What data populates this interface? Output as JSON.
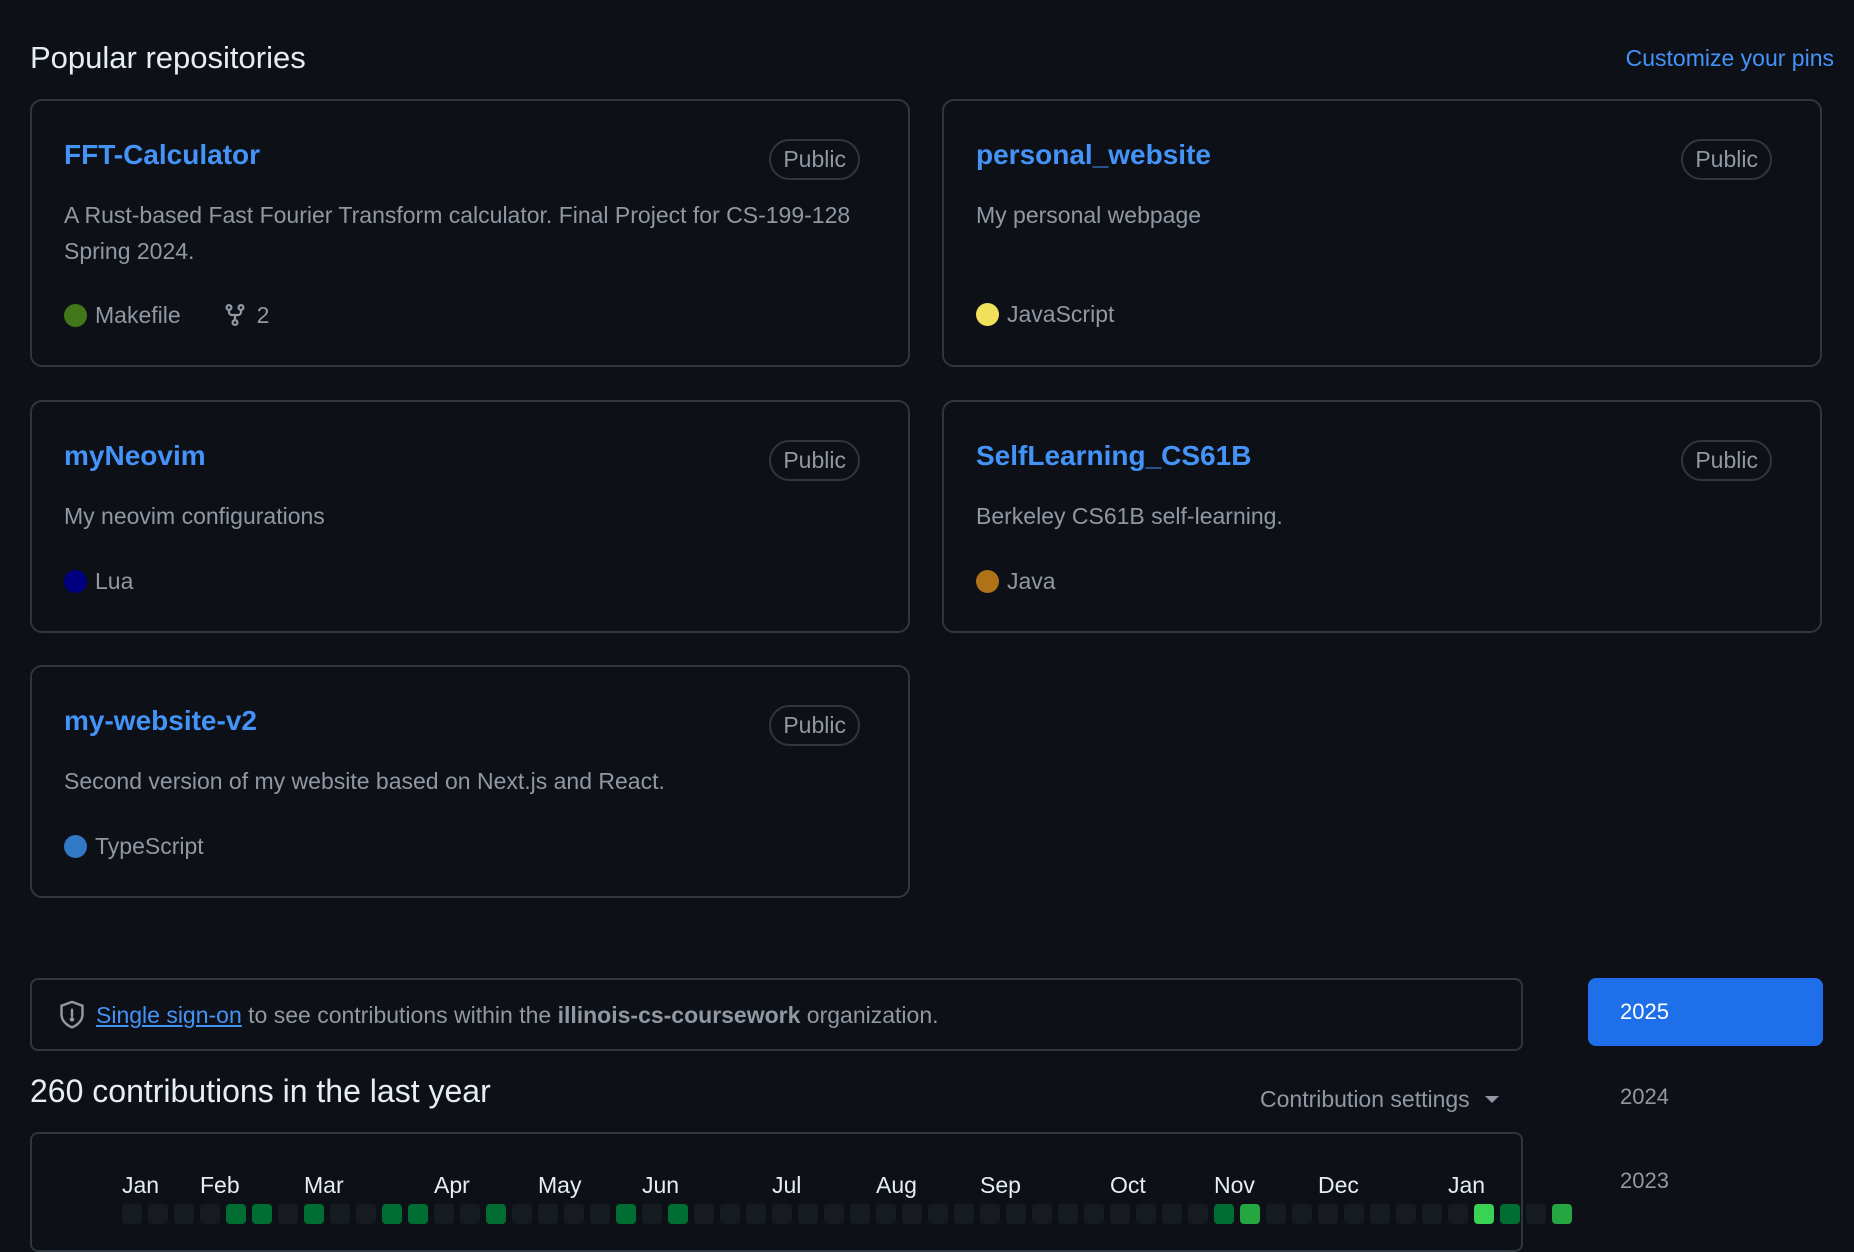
{
  "header": {
    "title": "Popular repositories",
    "customize_label": "Customize your pins"
  },
  "repos": [
    {
      "name": "FFT-Calculator",
      "visibility": "Public",
      "description": "A Rust-based Fast Fourier Transform calculator. Final Project for CS-199-128 Spring 2024.",
      "language": "Makefile",
      "language_color": "#427819",
      "forks": "2"
    },
    {
      "name": "personal_website",
      "visibility": "Public",
      "description": "My personal webpage",
      "language": "JavaScript",
      "language_color": "#f1e05a"
    },
    {
      "name": "myNeovim",
      "visibility": "Public",
      "description": "My neovim configurations",
      "language": "Lua",
      "language_color": "#000080"
    },
    {
      "name": "SelfLearning_CS61B",
      "visibility": "Public",
      "description": "Berkeley CS61B self-learning.",
      "language": "Java",
      "language_color": "#b07219"
    },
    {
      "name": "my-website-v2",
      "visibility": "Public",
      "description": "Second version of my website based on Next.js and React.",
      "language": "TypeScript",
      "language_color": "#3178c6"
    }
  ],
  "sso": {
    "link_label": "Single sign-on",
    "text_before_org": " to see contributions within the ",
    "org": "illinois-cs-coursework",
    "text_after_org": " organization."
  },
  "contributions": {
    "title": "260 contributions in the last year",
    "settings_label": "Contribution settings",
    "months": [
      "Jan",
      "Feb",
      "Mar",
      "Apr",
      "May",
      "Jun",
      "Jul",
      "Aug",
      "Sep",
      "Oct",
      "Nov",
      "Dec",
      "Jan"
    ],
    "visible_row_levels": [
      0,
      0,
      0,
      0,
      2,
      2,
      0,
      2,
      0,
      0,
      2,
      2,
      0,
      0,
      2,
      0,
      0,
      0,
      0,
      2,
      0,
      2,
      0,
      0,
      0,
      0,
      0,
      0,
      0,
      0,
      0,
      0,
      0,
      0,
      0,
      0,
      0,
      0,
      0,
      0,
      0,
      0,
      2,
      3,
      0,
      0,
      0,
      0,
      0,
      0,
      0,
      0,
      4,
      2,
      0,
      3
    ],
    "level_colors": [
      "#161b22",
      "#0e4429",
      "#006d32",
      "#26a641",
      "#39d353"
    ]
  },
  "years": [
    "2025",
    "2024",
    "2023"
  ],
  "colors": {
    "accent": "#4493f8",
    "active_year_bg": "#1f6feb"
  }
}
